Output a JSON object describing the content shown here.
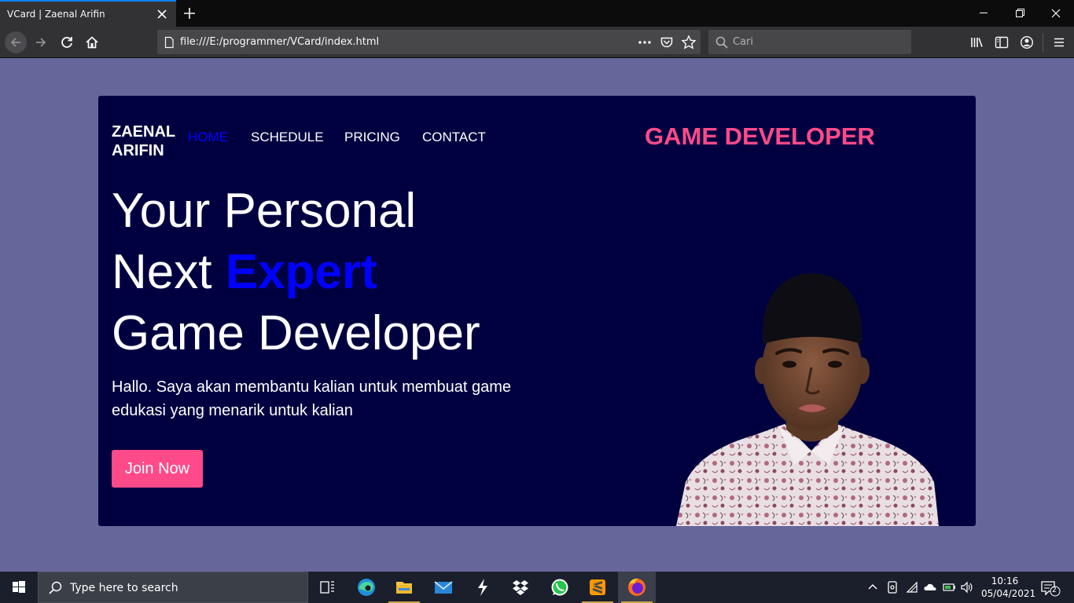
{
  "browser": {
    "tab_title": "VCard | Zaenal Arifin",
    "url": "file:///E:/programmer/VCard/index.html",
    "search_placeholder": "Cari"
  },
  "site": {
    "brand_line1": "ZAENAL",
    "brand_line2": "ARIFIN",
    "nav": [
      "HOME",
      "SCHEDULE",
      "PRICING",
      "CONTACT"
    ],
    "active_nav": "HOME",
    "role": "GAME DEVELOPER",
    "headline_line1": "Your Personal",
    "headline_line2_pre": "Next ",
    "headline_line2_accent": "Expert",
    "headline_line3": "Game Developer",
    "description": "Hallo. Saya akan membantu kalian untuk membuat game edukasi yang menarik untuk kalian",
    "cta": "Join Now"
  },
  "taskbar": {
    "search_placeholder": "Type here to search",
    "time": "10:16",
    "date": "05/04/2021",
    "notification_count": "2",
    "apps": [
      "task-view",
      "edge",
      "file-explorer",
      "mail",
      "deezer",
      "dropbox",
      "whatsapp",
      "sublime-text",
      "firefox"
    ]
  },
  "colors": {
    "page_bg": "#66669a",
    "hero_bg": "#000040",
    "accent_pink": "#ff4a8a",
    "accent_blue": "#0000ff"
  }
}
